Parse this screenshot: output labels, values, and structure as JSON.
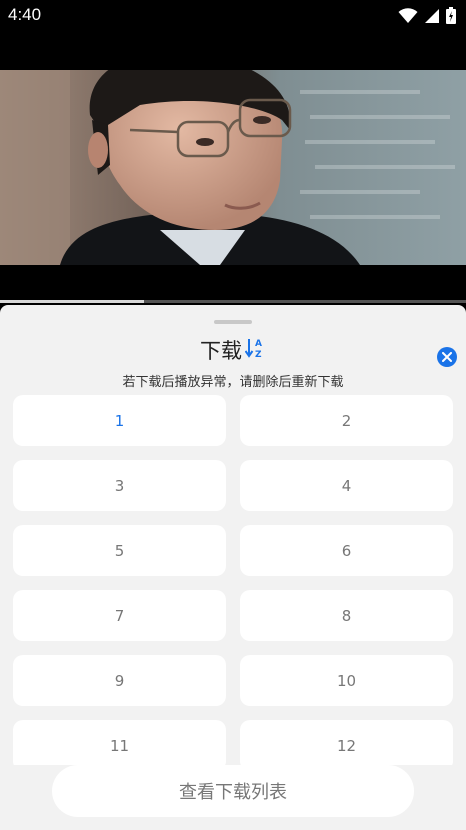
{
  "status_bar": {
    "time": "4:40"
  },
  "player": {
    "progress": 0.31
  },
  "sheet": {
    "title": "下载",
    "note": "若下载后播放异常，请删除后重新下载",
    "sort_icon": "sort-az-icon",
    "close_icon": "close-icon",
    "accent_color": "#1a73e8",
    "episodes": [
      "1",
      "2",
      "3",
      "4",
      "5",
      "6",
      "7",
      "8",
      "9",
      "10",
      "11",
      "12"
    ],
    "selected_episode": "1",
    "download_list_label": "查看下载列表"
  }
}
